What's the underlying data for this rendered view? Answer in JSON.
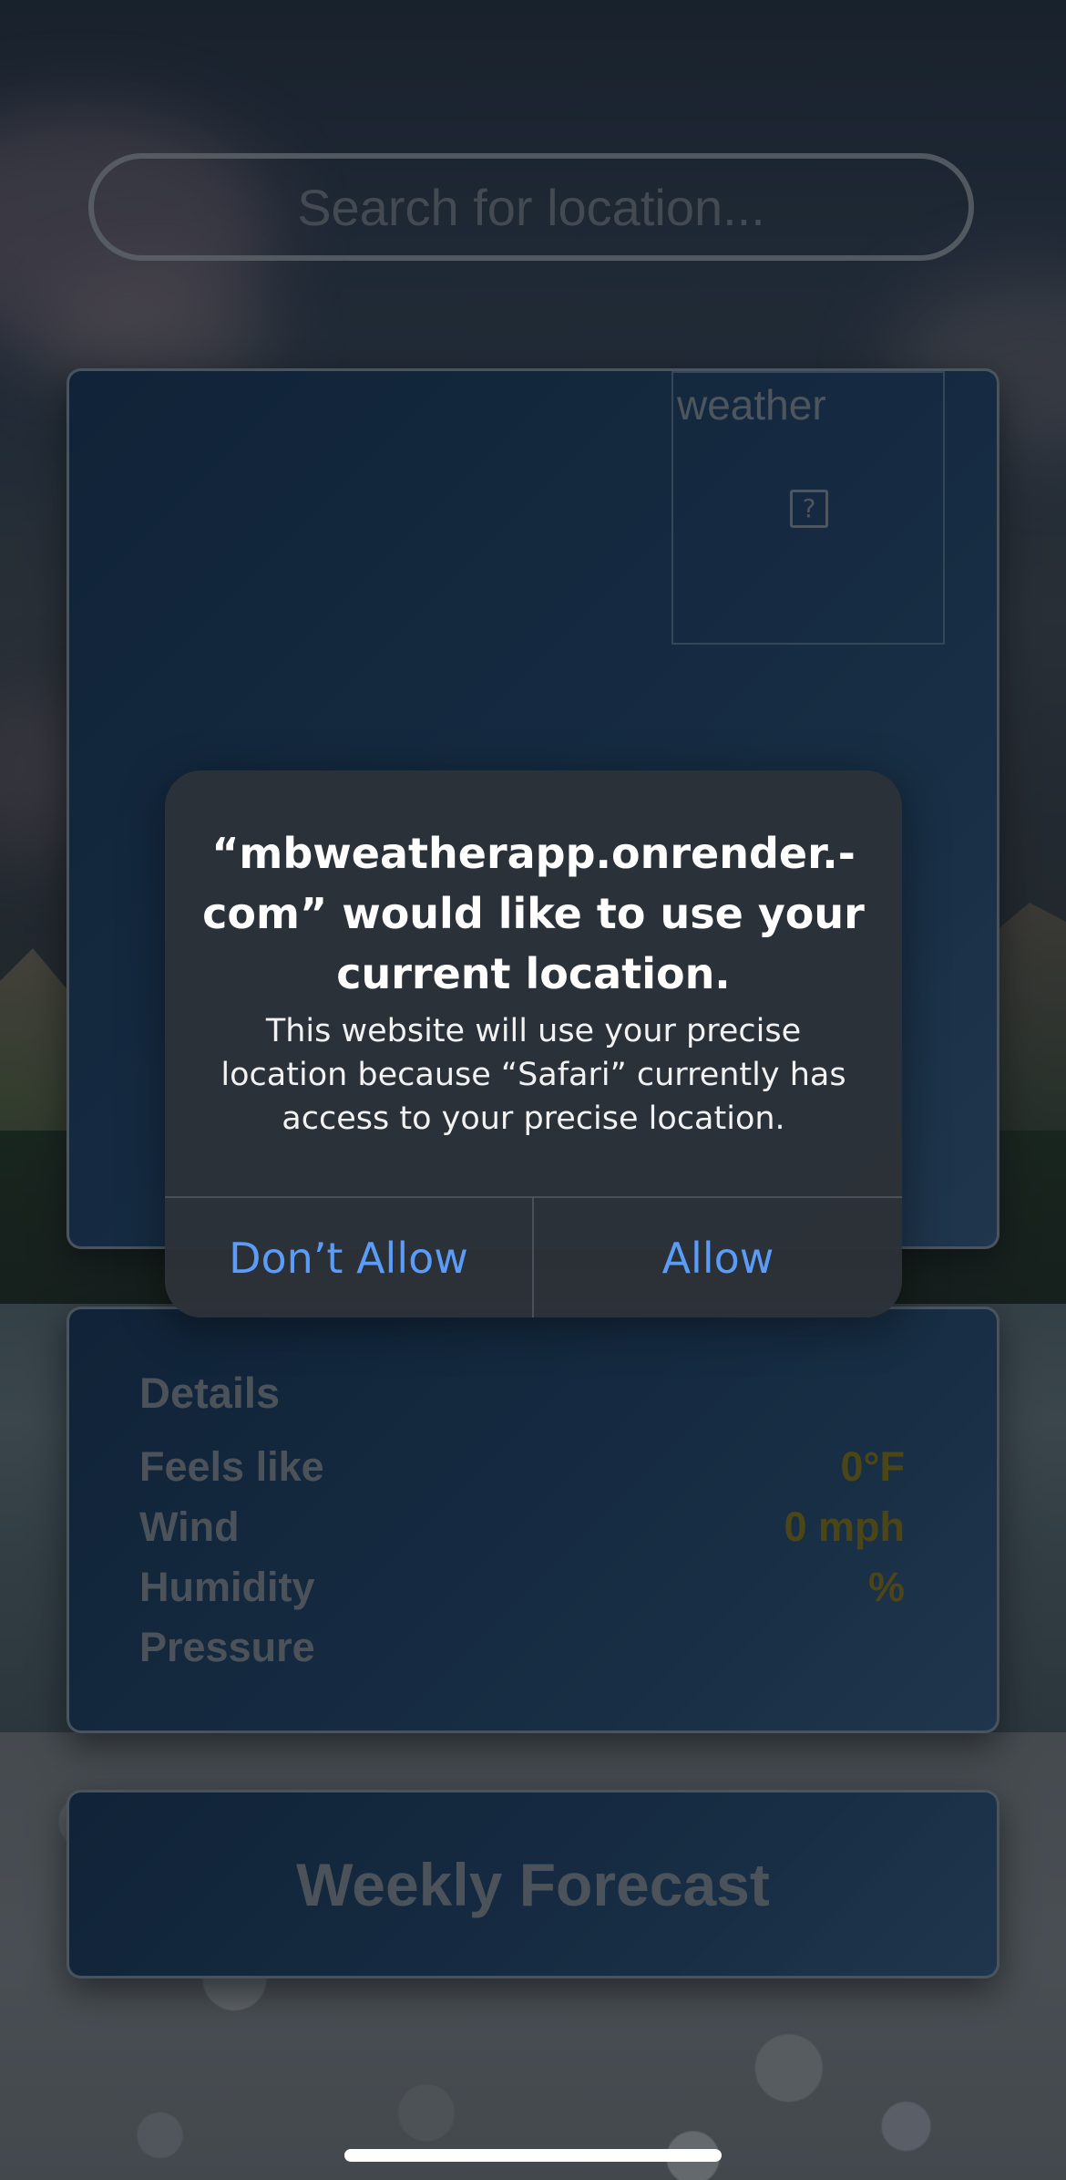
{
  "search": {
    "placeholder": "Search for location..."
  },
  "current_weather": {
    "image_alt": "weather",
    "broken_image_glyph": "?"
  },
  "details": {
    "title": "Details",
    "rows": [
      {
        "label": "Feels like",
        "value": "0°F"
      },
      {
        "label": "Wind",
        "value": "0 mph"
      },
      {
        "label": "Humidity",
        "value": "%"
      },
      {
        "label": "Pressure",
        "value": ""
      }
    ]
  },
  "weekly": {
    "title": "Weekly Forecast"
  },
  "alert": {
    "title": "“mbweatherapp.onrender.-com” would like to use your current location.",
    "message": "This website will use your precise location because “Safari” currently has access to your precise location.",
    "deny_label": "Don’t Allow",
    "allow_label": "Allow"
  },
  "colors": {
    "accent_link": "#5a9cf8",
    "detail_value": "#7a6a10",
    "card_background": "#143456"
  },
  "icons": {
    "broken_image": "broken-image-icon"
  }
}
